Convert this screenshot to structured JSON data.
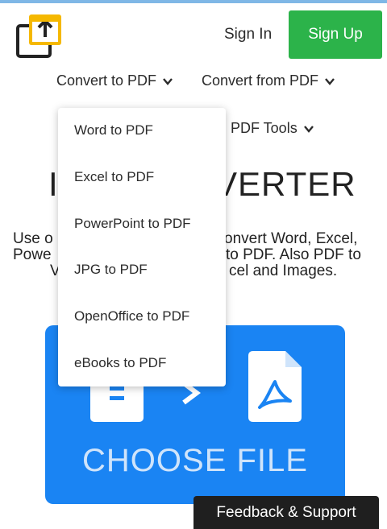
{
  "header": {
    "sign_in": "Sign In",
    "sign_up": "Sign Up",
    "accent": "#2cb34a"
  },
  "nav": {
    "convert_to": "Convert to PDF",
    "convert_from": "Convert from PDF",
    "pdf_tools": "PDF Tools"
  },
  "dropdown": {
    "items": [
      "Word to PDF",
      "Excel to PDF",
      "PowerPoint to PDF",
      "JPG to PDF",
      "OpenOffice to PDF",
      "eBooks to PDF"
    ]
  },
  "hero": {
    "title_fragment_left": "I",
    "title_fragment_right": "VERTER",
    "desc_line1_left": "Use o",
    "desc_line1_right": "onvert Word, Excel,",
    "desc_line2_left": "Powe",
    "desc_line2_right": "to PDF. Also PDF to",
    "desc_line3_left": "V",
    "desc_line3_right": "cel and Images."
  },
  "dropzone": {
    "label": "CHOOSE FILE",
    "bg": "#1a84f3"
  },
  "footer": {
    "feedback": "Feedback & Support"
  }
}
